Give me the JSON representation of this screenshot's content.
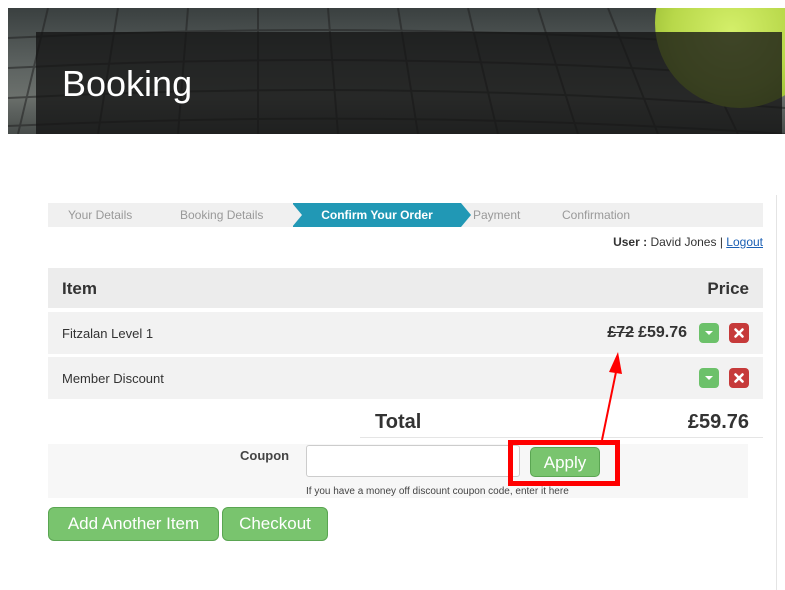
{
  "hero": {
    "title": "Booking"
  },
  "steps": [
    {
      "label": "Your Details",
      "active": false
    },
    {
      "label": "Booking Details",
      "active": false
    },
    {
      "label": "Confirm Your Order",
      "active": true
    },
    {
      "label": "Payment",
      "active": false
    },
    {
      "label": "Confirmation",
      "active": false
    }
  ],
  "user": {
    "prefix": "User :",
    "name": "David Jones",
    "separator": "|",
    "logout": "Logout"
  },
  "table": {
    "header_item": "Item",
    "header_price": "Price",
    "rows": [
      {
        "name": "Fitzalan Level 1",
        "old_price": "£72",
        "price": "£59.76"
      },
      {
        "name": "Member Discount",
        "old_price": "",
        "price": ""
      }
    ],
    "total_label": "Total",
    "total_value": "£59.76"
  },
  "coupon": {
    "label": "Coupon",
    "value": "",
    "placeholder": "",
    "apply_label": "Apply",
    "help": "If you have a money off discount coupon code, enter it here"
  },
  "actions": {
    "add_label": "Add Another Item",
    "checkout_label": "Checkout"
  },
  "colors": {
    "accent": "#2198b5",
    "button": "#79c46e",
    "delete": "#c63a3a",
    "highlight": "#ff0000"
  },
  "icons": [
    "chevron-down-icon",
    "close-icon"
  ]
}
